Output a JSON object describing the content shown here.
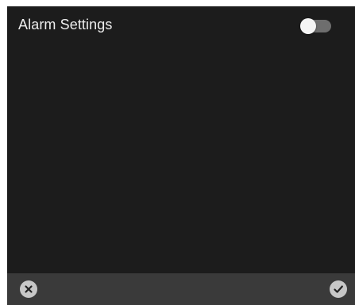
{
  "header": {
    "title": "Alarm Settings",
    "toggle_state": "off"
  },
  "footer": {
    "cancel_icon": "close-icon",
    "confirm_icon": "check-icon"
  },
  "colors": {
    "panel_background": "#1c1c1c",
    "footer_background": "#3a3a3a",
    "title_text": "#ededed",
    "toggle_track": "#6e6e6e",
    "toggle_thumb": "#f5f5f5",
    "footer_button": "#c7c7c7"
  }
}
